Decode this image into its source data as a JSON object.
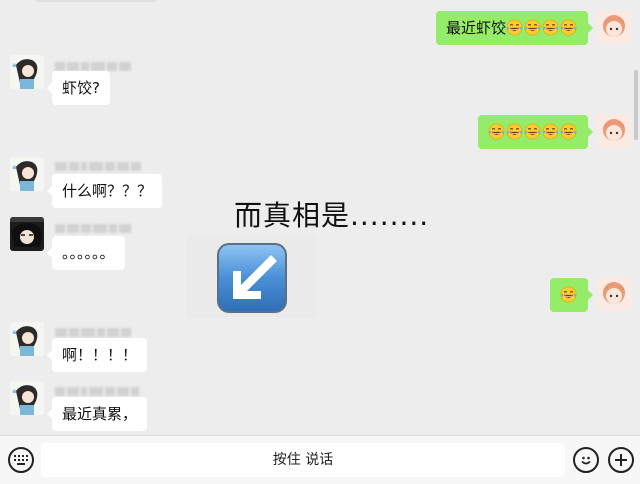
{
  "messages": [
    {
      "side": "right",
      "text": "最近虾饺",
      "emoji_count": 4
    },
    {
      "side": "left",
      "text": "虾饺?"
    },
    {
      "side": "right",
      "text": "",
      "emoji_count": 5
    },
    {
      "side": "left",
      "text": "什么啊？？？"
    },
    {
      "side": "left",
      "text": "。。。。。。"
    },
    {
      "side": "right",
      "text": "",
      "emoji_count": 1
    },
    {
      "side": "left",
      "text": "啊！！！！"
    },
    {
      "side": "left",
      "text": "最近真累，"
    }
  ],
  "overlay": {
    "caption": "而真相是........",
    "arrow_icon": "down-left-arrow-icon"
  },
  "input_bar": {
    "hold_to_talk": "按住 说话",
    "left_icon": "keyboard-icon",
    "emoji_icon": "smiley-icon",
    "plus_icon": "plus-icon"
  },
  "emoji_name": "tears-of-joy-emoji",
  "colors": {
    "background": "#ededed",
    "bubble_self": "#95ec69",
    "bubble_other": "#ffffff",
    "arrow_blue": "#4a8fd6"
  }
}
